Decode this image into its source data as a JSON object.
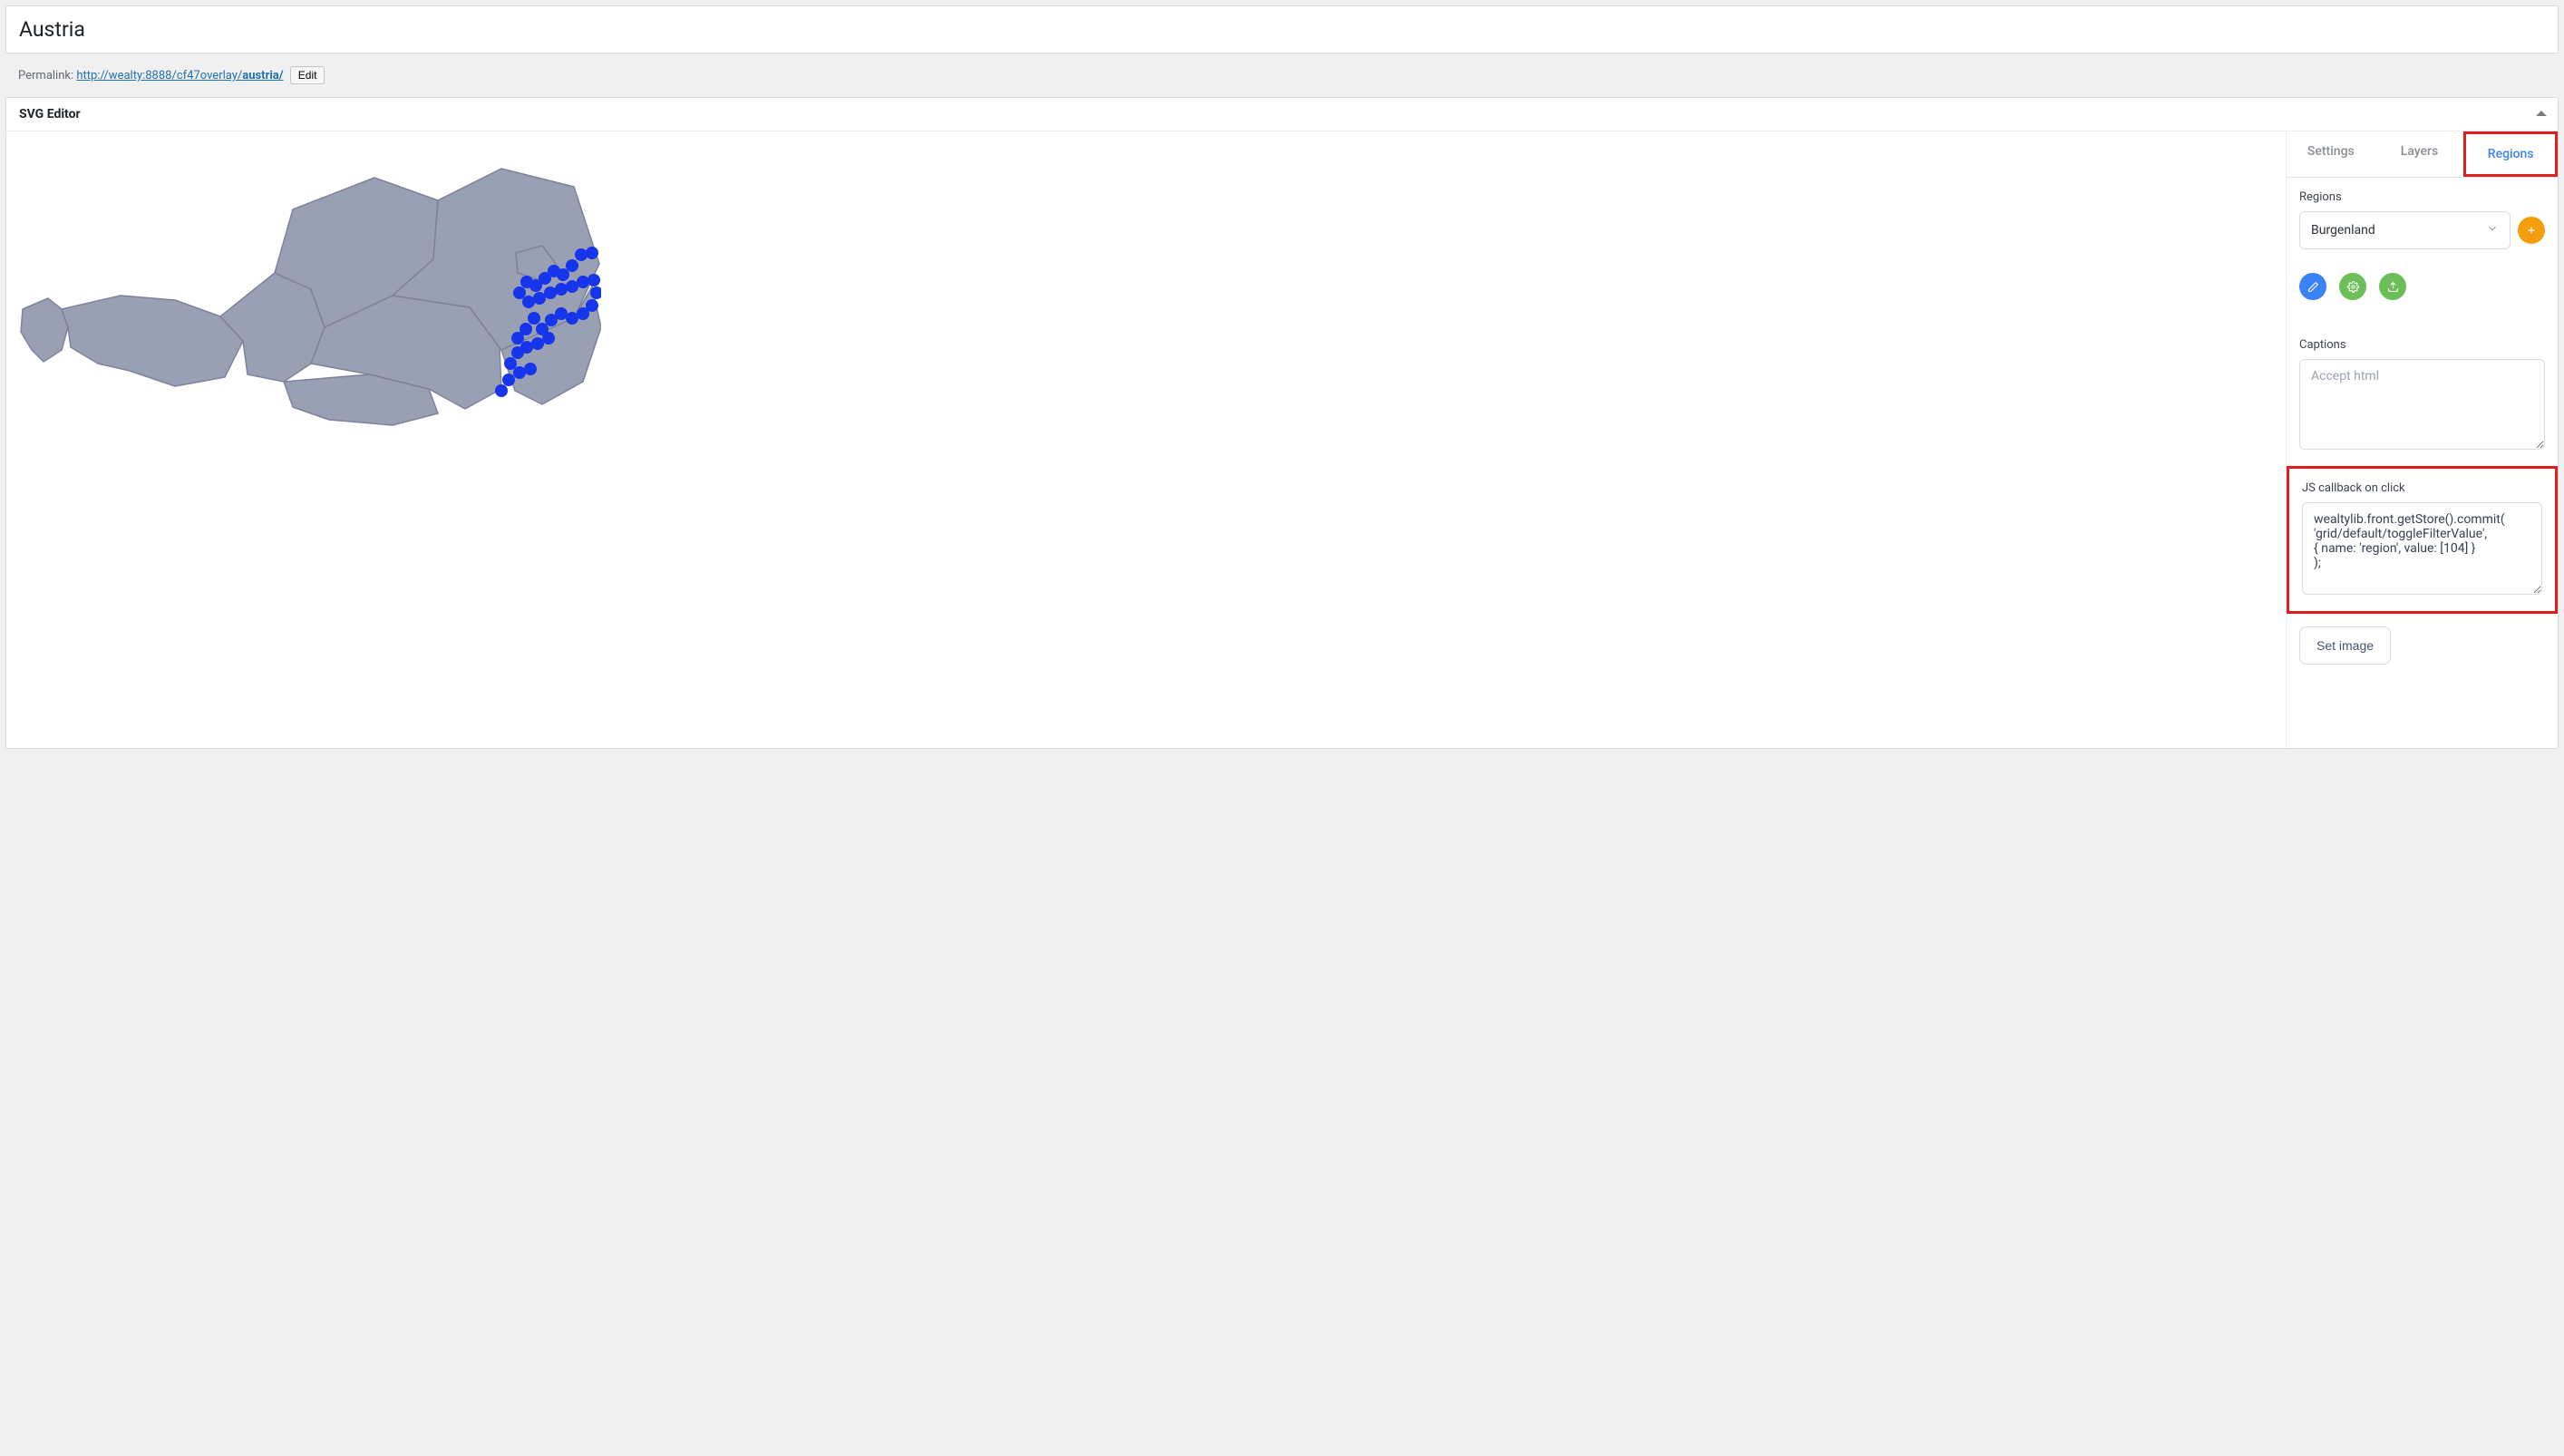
{
  "title": "Austria",
  "permalink": {
    "label": "Permalink:",
    "base": "http://wealty:8888/cf47overlay/",
    "slug": "austria/",
    "edit_label": "Edit"
  },
  "panel_title": "SVG Editor",
  "tabs": {
    "settings": "Settings",
    "layers": "Layers",
    "regions": "Regions"
  },
  "regions": {
    "label": "Regions",
    "selected": "Burgenland"
  },
  "captions": {
    "label": "Captions",
    "placeholder": "Accept html",
    "value": ""
  },
  "js_callback": {
    "label": "JS callback on click",
    "value": "wealtylib.front.getStore().commit(\n'grid/default/toggleFilterValue',\n{ name: 'region', value: [104] }\n);"
  },
  "set_image_label": "Set image",
  "icons": {
    "add": "plus-icon",
    "pen": "pen-icon",
    "gear": "gear-icon",
    "upload": "upload-icon"
  }
}
